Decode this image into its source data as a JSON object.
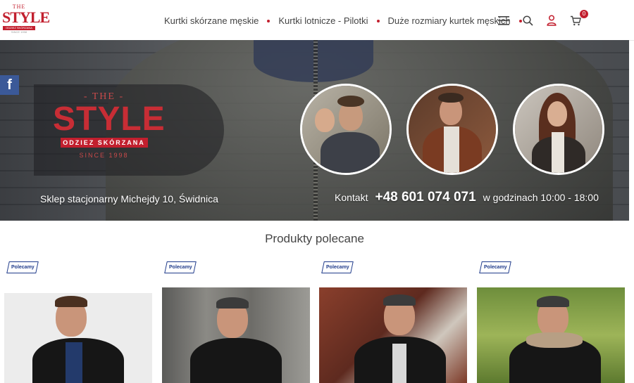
{
  "header": {
    "logo": {
      "the": "THE",
      "style": "STYLE",
      "band": "ODZIEZ SKÓRZANA",
      "since": "SINCE 1998"
    },
    "nav": [
      {
        "label": "Kurtki skórzane męskie"
      },
      {
        "label": "Kurtki lotnicze - Pilotki"
      },
      {
        "label": "Duże rozmiary kurtek męskich"
      }
    ],
    "icons": [
      "menu-icon",
      "search-icon",
      "user-icon",
      "cart-icon"
    ],
    "cart_count": "0"
  },
  "hero": {
    "logo": {
      "the": "- THE -",
      "style": "STYLE",
      "band": "ODZIEZ SKÓRZANA",
      "since": "SINCE 1998"
    },
    "store_text": "Sklep stacjonarny Michejdy 10, Świdnica",
    "contact_label": "Kontakt",
    "phone": "+48 601 074 071",
    "hours": "w godzinach 10:00 - 18:00",
    "facebook": "f"
  },
  "section": {
    "title": "Produkty polecane"
  },
  "products": [
    {
      "tag": "Polecamy"
    },
    {
      "tag": "Polecamy"
    },
    {
      "tag": "Polecamy"
    },
    {
      "tag": "Polecamy"
    }
  ],
  "colors": {
    "brand": "#c21f2e",
    "facebook": "#3b5998",
    "tag": "#1e3a8a"
  }
}
